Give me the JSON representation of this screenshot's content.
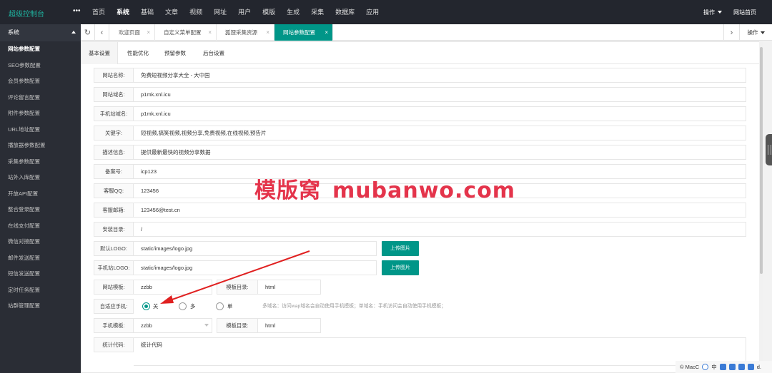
{
  "header": {
    "logo": "超级控制台",
    "more": "•••",
    "nav": [
      "首页",
      "系统",
      "基础",
      "文章",
      "视频",
      "网址",
      "用户",
      "模版",
      "生成",
      "采集",
      "数据库",
      "应用"
    ],
    "active_nav": "系统",
    "ops_label": "操作",
    "site_home": "网站首页"
  },
  "sidebar": {
    "title": "系统",
    "items": [
      "网站参数配置",
      "SEO参数配置",
      "会员参数配置",
      "评论留言配置",
      "附件参数配置",
      "URL地址配置",
      "播放器参数配置",
      "采集参数配置",
      "站外入库配置",
      "开放API配置",
      "整合登录配置",
      "在线支付配置",
      "微信对接配置",
      "邮件发送配置",
      "短信发送配置",
      "定时任务配置",
      "站群管理配置"
    ],
    "active": "网站参数配置"
  },
  "tabs": {
    "items": [
      "欢迎页面",
      "自定义菜单配置",
      "狐狸采集资源",
      "网站参数配置"
    ],
    "active": "网站参数配置",
    "ops_label": "操作"
  },
  "subtabs": [
    "基本设置",
    "性能优化",
    "预留参数",
    "后台设置"
  ],
  "form": {
    "site_name": {
      "label": "网站名称:",
      "value": "免费短视频分享大全 - 大中国"
    },
    "domain": {
      "label": "网站域名:",
      "value": "p1mk.xnl.icu"
    },
    "mobile_domain": {
      "label": "手机站域名:",
      "value": "p1mk.xnl.icu"
    },
    "keywords": {
      "label": "关键字:",
      "value": "短视频,搞笑视频,视频分享,免费视频,在线视频,预告片"
    },
    "description": {
      "label": "描述信息:",
      "value": "提供最新最快的视频分享数据"
    },
    "icp": {
      "label": "备案号:",
      "value": "icp123"
    },
    "qq": {
      "label": "客服QQ:",
      "value": "123456"
    },
    "email": {
      "label": "客服邮箱:",
      "value": "123456@test.cn"
    },
    "install_dir": {
      "label": "安装目录:",
      "value": "/"
    },
    "logo": {
      "label": "默认LOGO:",
      "value": "static/images/logo.jpg",
      "button": "上传图片"
    },
    "mobile_logo": {
      "label": "手机站LOGO:",
      "value": "static/images/logo.jpg",
      "button": "上传图片"
    },
    "template": {
      "label": "网站模板:",
      "value": "zzbb",
      "dir_label": "模板目录:",
      "dir_value": "html"
    },
    "auto_mobile": {
      "label": "自适应手机:",
      "options": [
        "关闭",
        "多域",
        "单域"
      ],
      "selected": "关闭",
      "hint": "多域名：访问wap域名会自动使用手机模板；单域名：手机访问会自动使用手机模板；"
    },
    "mobile_template": {
      "label": "手机模板:",
      "value": "zzbb",
      "dir_label": "模板目录:",
      "dir_value": "html"
    },
    "stats": {
      "label": "统计代码:",
      "value": "统计代码"
    }
  },
  "watermark": {
    "cn": "模版窝",
    "en": "mubanwo.com"
  },
  "tray": {
    "text1": "© MacC",
    "ime": "中",
    "end": "d."
  },
  "colors": {
    "accent": "#009688",
    "header_bg": "#23262e",
    "sidebar_bg": "#2a2d35",
    "watermark": "#e4344b",
    "arrow": "#e02020"
  }
}
